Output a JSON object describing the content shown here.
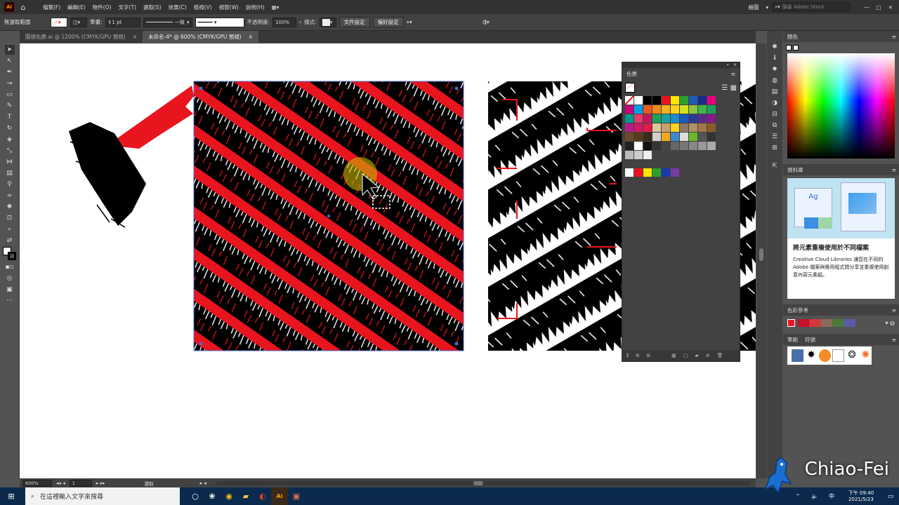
{
  "menubar": {
    "app": "Ai",
    "items": [
      "檔案(F)",
      "編輯(E)",
      "物件(O)",
      "文字(T)",
      "選取(S)",
      "效果(C)",
      "檢視(V)",
      "視窗(W)",
      "說明(H)"
    ],
    "workspace": "繪圖",
    "search_placeholder": "搜尋 Adobe Stock"
  },
  "controlbar": {
    "no_selection": "無選取範圍",
    "stroke_label": "筆畫:",
    "stroke_value": "1 pt",
    "stroke_style": "一致",
    "opacity_label": "不透明度:",
    "opacity_value": "100%",
    "style_label": "樣式:",
    "doc_setup": "文件設定",
    "preferences": "偏好設定"
  },
  "tabs": [
    {
      "label": "圖樣色票.ai @ 1200% (CMYK/GPU 預視)",
      "close": "×"
    },
    {
      "label": "未命名-4* @ 600% (CMYK/GPU 預視)",
      "close": "×"
    }
  ],
  "swatches_panel": {
    "title": "色票"
  },
  "right_panels": {
    "color": "顏色",
    "library": "資料庫",
    "lib_title": "將元素重複使用於不同檔案",
    "lib_desc": "Creative Cloud Libraries 讓您在不同的 Adobe 檔案與應用程式間分享並重複使用創意內容元素組。",
    "lib_ag": "Ag",
    "color_guide": "色彩參考",
    "brushes_tab": "筆刷",
    "symbols_tab": "符號"
  },
  "statusbar": {
    "zoom": "600%",
    "page": "1",
    "mode": "選取"
  },
  "taskbar": {
    "search_placeholder": "在這裡輸入文字來搜尋",
    "ai_label": "Ai",
    "lang": "中",
    "time": "下午 09:40",
    "date": "2021/5/23"
  },
  "watermark": "Chiao-Fei",
  "colors": {
    "accent_red": "#e8141e",
    "black": "#000000"
  }
}
